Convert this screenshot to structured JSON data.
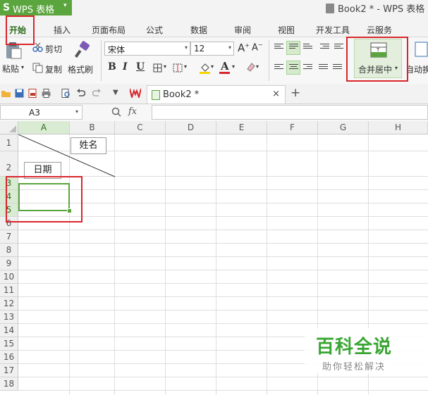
{
  "app": {
    "logo": "S",
    "name": "WPS 表格",
    "menu_arrow": "▾",
    "window_title": "Book2 * - WPS 表格"
  },
  "menu": {
    "tabs": [
      "开始",
      "插入",
      "页面布局",
      "公式",
      "数据",
      "审阅",
      "视图",
      "开发工具",
      "云服务"
    ],
    "active": "开始"
  },
  "ribbon": {
    "clipboard": {
      "paste": "粘贴",
      "cut": "剪切",
      "copy": "复制",
      "format_painter": "格式刷"
    },
    "font": {
      "name": "宋体",
      "size": "12",
      "bold": "B",
      "italic": "I",
      "underline": "U",
      "font_color_glyph": "A"
    },
    "alignment": {
      "merge_center": "合并居中",
      "wrap": "自动换"
    }
  },
  "document_tab": {
    "label": "Book2 *",
    "close": "×",
    "new_tab": "+"
  },
  "formula_bar": {
    "cell_ref": "A3",
    "fx": "fx",
    "content": ""
  },
  "sheet": {
    "columns": [
      "A",
      "B",
      "C",
      "D",
      "E",
      "F",
      "G",
      "H"
    ],
    "rows": [
      "1",
      "2",
      "3",
      "4",
      "5",
      "6",
      "7",
      "8",
      "9",
      "10",
      "11",
      "12",
      "13",
      "14",
      "15",
      "16",
      "17",
      "18"
    ],
    "selected_column": "A",
    "selected_rows": [
      "3",
      "4",
      "5"
    ],
    "textbox_name": "姓名",
    "textbox_date": "日期"
  },
  "watermark": {
    "title": "百科全说",
    "subtitle": "助你轻松解决"
  },
  "colors": {
    "brand": "#5aa53d",
    "highlight": "#d8262c",
    "selection": "#5aa53d",
    "font_red": "#d8262c",
    "fill_yellow": "#f5d400"
  }
}
